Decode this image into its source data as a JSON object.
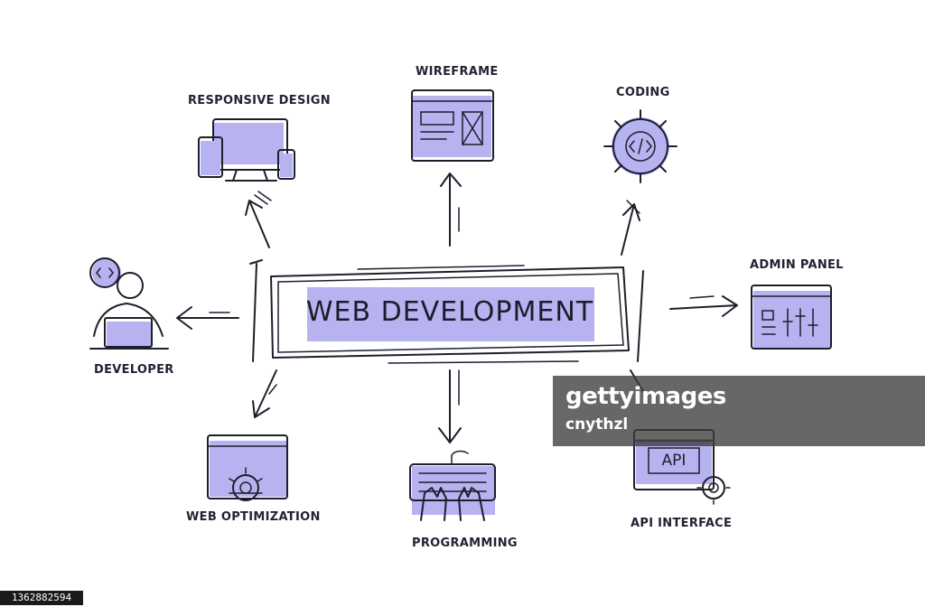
{
  "center": {
    "title": "WEB DEVELOPMENT"
  },
  "nodes": {
    "responsive_design": "RESPONSIVE DESIGN",
    "wireframe": "WIREFRAME",
    "coding": "CODING",
    "developer": "DEVELOPER",
    "admin_panel": "ADMIN PANEL",
    "web_optimization": "WEB OPTIMIZATION",
    "programming": "PROGRAMMING",
    "api_interface": "API INTERFACE"
  },
  "icons": {
    "api_badge": "API",
    "names": [
      "devices-icon",
      "wireframe-icon",
      "code-gear-icon",
      "developer-person-icon",
      "admin-panel-icon",
      "web-optimization-icon",
      "keyboard-hands-icon",
      "api-window-icon"
    ]
  },
  "watermark": {
    "logo": "gettyimages",
    "credit": "cnythzl"
  },
  "image_id": "1362882594",
  "colors": {
    "accent": "#b7b3f0",
    "ink": "#1e1e2c",
    "background": "#ffffff"
  }
}
